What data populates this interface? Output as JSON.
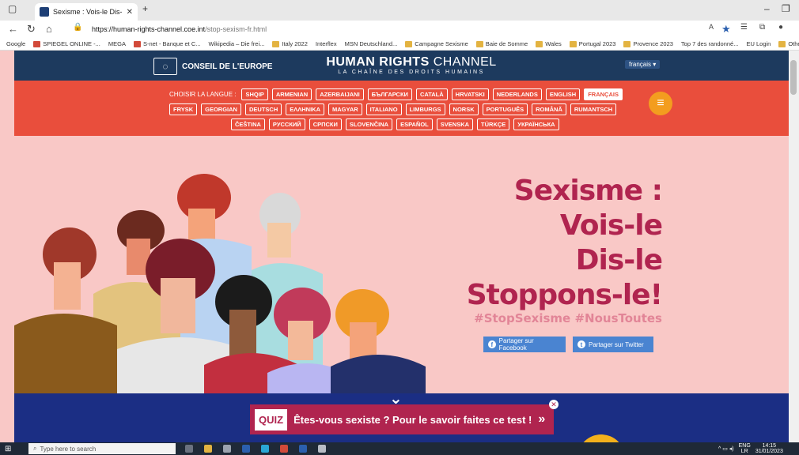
{
  "browser": {
    "tab_title": "Sexisme : Vois-le Dis-le Stoppon",
    "url_host": "https://human-rights-channel.coe.int",
    "url_path": "/stop-sexism-fr.html",
    "bookmarks": [
      {
        "label": "Google",
        "color": "none"
      },
      {
        "label": "SPIEGEL ONLINE -...",
        "color": "red"
      },
      {
        "label": "MEGA",
        "color": "none"
      },
      {
        "label": "S-net - Banque et C...",
        "color": "red"
      },
      {
        "label": "Wikipedia – Die frei...",
        "color": "none"
      },
      {
        "label": "Italy 2022",
        "color": "folder"
      },
      {
        "label": "Interflex",
        "color": "none"
      },
      {
        "label": "MSN Deutschland...",
        "color": "none"
      },
      {
        "label": "Campagne Sexisme",
        "color": "folder"
      },
      {
        "label": "Baie de Somme",
        "color": "folder"
      },
      {
        "label": "Wales",
        "color": "folder"
      },
      {
        "label": "Portugal 2023",
        "color": "folder"
      },
      {
        "label": "Provence 2023",
        "color": "folder"
      },
      {
        "label": "Top 7 des randonné...",
        "color": "none"
      },
      {
        "label": "EU Login",
        "color": "none"
      },
      {
        "label": "Other fav",
        "color": "folder"
      }
    ]
  },
  "site": {
    "coe_label": "CONSEIL DE L'EUROPE",
    "brand_main": "HUMAN RIGHTS",
    "brand_light": "CHANNEL",
    "brand_sub": "LA CHAÎNE DES DROITS HUMAINS",
    "language_select": "français ▾",
    "chooser_label": "CHOISIR LA LANGUE :",
    "languages_row1": [
      "SHQIP",
      "ARMENIAN",
      "AZERBAIJANI",
      "БЪЛГАРСКИ",
      "CATALÀ",
      "HRVATSKI",
      "NEDERLANDS",
      "ENGLISH",
      "FRANÇAIS"
    ],
    "languages_row2": [
      "FRYSK",
      "GEORGIAN",
      "DEUTSCH",
      "ΕΛΛΗΝΙΚΑ",
      "MAGYAR",
      "ITALIANO",
      "LIMBURGS",
      "NORSK",
      "PORTUGUÊS",
      "ROMÂNĂ",
      "RUMANTSCH"
    ],
    "languages_row3": [
      "ČEŠTINA",
      "РУССКИЙ",
      "СРПСКИ",
      "SLOVENČINA",
      "ESPAÑOL",
      "SVENSKA",
      "TÜRKÇE",
      "УКРАЇНСЬКА"
    ],
    "active_language": "FRANÇAIS"
  },
  "hero": {
    "title_lines": [
      "Sexisme :",
      "Vois-le",
      "Dis-le",
      "Stoppons-le!"
    ],
    "hashtags": "#StopSexisme #NousToutes",
    "share_facebook": "Partager sur Facebook",
    "share_twitter": "Partager sur Twitter"
  },
  "quiz": {
    "label": "QUIZ",
    "text": "Êtes-vous sexiste ? Pour le savoir faites ce test !",
    "arrow": "»"
  },
  "taskbar": {
    "search_placeholder": "Type here to search",
    "lang": "ENG",
    "lang_sub": "LR",
    "time": "14:15",
    "date": "31/01/2023"
  },
  "colors": {
    "header_navy": "#1d3a5e",
    "lang_bar": "#e94e3c",
    "hero_pink": "#f9c8c6",
    "title_crimson": "#b0244f",
    "hashtag_pink": "#e28597",
    "share_blue": "#4a84d1",
    "band_blue": "#1b2e84"
  }
}
